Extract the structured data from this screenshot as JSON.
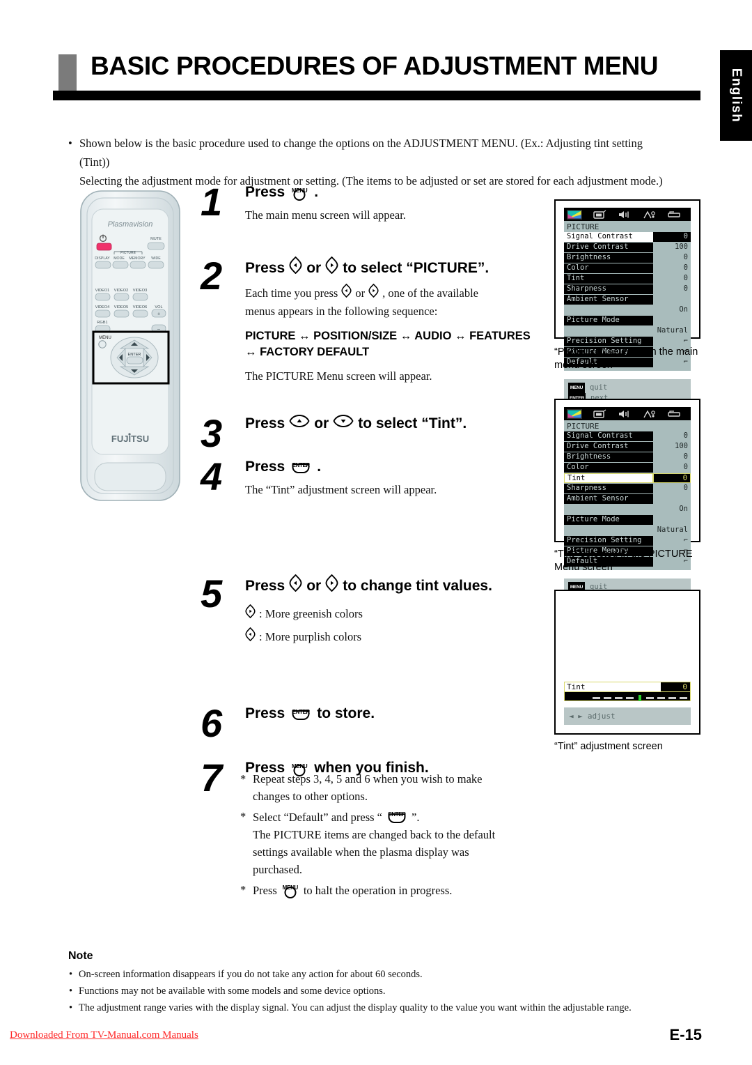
{
  "header": {
    "title": "BASIC PROCEDURES OF ADJUSTMENT MENU",
    "language_tab": "English"
  },
  "intro": {
    "line1": "Shown below is the basic procedure used to change the options on the ADJUSTMENT MENU. (Ex.: Adjusting tint setting (Tint))",
    "line2": "Selecting the adjustment mode for adjustment or setting. (The items to be adjusted or set are stored for each adjustment mode.)",
    "bullet": "•"
  },
  "remote": {
    "brand_top": "Plasmavision",
    "brand_bottom": "FUJITSU",
    "power_symbol": "⏻",
    "mute": "MUTE",
    "picture_group": "PICTURE",
    "display": "DISPLAY",
    "mode": "MODE",
    "memory": "MEMORY",
    "wide": "WIDE",
    "video1": "VIDEO1",
    "video2": "VIDEO2",
    "video3": "VIDEO3",
    "video4": "VIDEO4",
    "video5": "VIDEO5",
    "video6": "VIDEO6",
    "vol": "VOL",
    "vol_plus": "+",
    "vol_minus": "–",
    "rgb1": "RGB1",
    "menu": "MENU",
    "enter": "ENTER"
  },
  "buttons": {
    "menu_label": "MENU",
    "enter_label": "ENTER"
  },
  "steps": [
    {
      "num": "1",
      "head_pre": "Press",
      "head_post": ".",
      "sub": "The main menu screen will appear."
    },
    {
      "num": "2",
      "head_pre": "Press",
      "head_mid": "or",
      "head_post": "to select “PICTURE”.",
      "sub_pre": "Each time you press",
      "sub_mid": "or",
      "sub_post": ", one of the available",
      "sub_line2": "menus appears in the following sequence:",
      "sequence_line1": "PICTURE ↔ POSITION/SIZE ↔ AUDIO ↔ FEATURES",
      "sequence_line2": "↔ FACTORY DEFAULT",
      "sub_tail": "The PICTURE Menu screen will appear."
    },
    {
      "num": "3",
      "head_pre": "Press",
      "head_mid": "or",
      "head_post": "to select “Tint”."
    },
    {
      "num": "4",
      "head_pre": "Press",
      "head_post": ".",
      "sub": "The “Tint” adjustment screen will appear."
    },
    {
      "num": "5",
      "head_pre": "Press",
      "head_mid": "or",
      "head_post": "to change tint values.",
      "opt_right": ": More greenish colors",
      "opt_left": ": More purplish colors"
    },
    {
      "num": "6",
      "head_pre": "Press",
      "head_post": "to store."
    },
    {
      "num": "7",
      "head_pre": "Press",
      "head_post": "when you finish."
    }
  ],
  "footnotes": {
    "star": "*",
    "n1_line1": "Repeat steps 3, 4, 5 and 6 when you wish to make",
    "n1_line2": "changes to other options.",
    "n2_pre": "Select “Default” and press “",
    "n2_post": "”.",
    "n2_line2": "The PICTURE items are changed back to the default",
    "n2_line3": "settings available when the plasma display was",
    "n2_line4": "purchased.",
    "n3_pre": "Press",
    "n3_post": "to halt the operation in progress."
  },
  "osd": {
    "menu_title": "PICTURE",
    "rows": [
      {
        "name": "Signal Contrast",
        "value": "0"
      },
      {
        "name": "Drive Contrast",
        "value": "100"
      },
      {
        "name": "Brightness",
        "value": "0"
      },
      {
        "name": "Color",
        "value": "0"
      },
      {
        "name": "Tint",
        "value": "0"
      },
      {
        "name": "Sharpness",
        "value": "0"
      },
      {
        "name": "Ambient Sensor",
        "value": "On"
      },
      {
        "name": "Picture Mode",
        "value": "Natural"
      },
      {
        "name": "Precision Setting",
        "value": "⌐"
      },
      {
        "name": "Picture Memory",
        "value": "⌐"
      },
      {
        "name": "Default",
        "value": "⌐"
      }
    ],
    "foot": {
      "menu_key": "MENU",
      "menu_action": "quit",
      "enter_key": "ENTER",
      "enter_action": "next"
    },
    "icons": [
      "picture-icon",
      "position-size-icon",
      "audio-icon",
      "features-icon",
      "factory-default-icon"
    ],
    "highlight_color": "#d8d86a",
    "row_bg": "#000000",
    "panel_bg": "#a9bcbc"
  },
  "osd_captions": {
    "first_l1": "“PICTURE” selected in the main",
    "first_l2": "menu screen",
    "second_l1": "“Tint” selected in the PICTURE",
    "second_l2": "Menu screen",
    "third": "“Tint” adjustment screen"
  },
  "tint_screen": {
    "label": "Tint",
    "value": "0",
    "foot_arrows": "◄ ►",
    "foot_action": "adjust"
  },
  "note": {
    "title": "Note",
    "bullet": "•",
    "items": [
      "On-screen information disappears if you do not take any action for about 60 seconds.",
      "Functions may not be available with some models and some device options.",
      "The adjustment range varies with the display signal. You can adjust the display quality to the value you want within the adjustable range."
    ]
  },
  "footer": {
    "download_link": "Downloaded From TV-Manual.com Manuals",
    "page_number": "E-15"
  }
}
